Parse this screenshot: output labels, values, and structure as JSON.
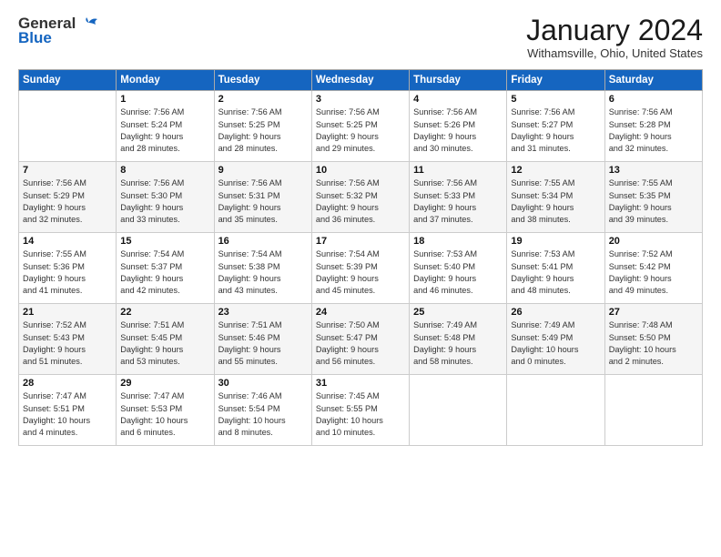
{
  "header": {
    "logo_general": "General",
    "logo_blue": "Blue",
    "month_title": "January 2024",
    "location": "Withamsville, Ohio, United States"
  },
  "days_of_week": [
    "Sunday",
    "Monday",
    "Tuesday",
    "Wednesday",
    "Thursday",
    "Friday",
    "Saturday"
  ],
  "weeks": [
    [
      {
        "day": "",
        "info": ""
      },
      {
        "day": "1",
        "info": "Sunrise: 7:56 AM\nSunset: 5:24 PM\nDaylight: 9 hours\nand 28 minutes."
      },
      {
        "day": "2",
        "info": "Sunrise: 7:56 AM\nSunset: 5:25 PM\nDaylight: 9 hours\nand 28 minutes."
      },
      {
        "day": "3",
        "info": "Sunrise: 7:56 AM\nSunset: 5:25 PM\nDaylight: 9 hours\nand 29 minutes."
      },
      {
        "day": "4",
        "info": "Sunrise: 7:56 AM\nSunset: 5:26 PM\nDaylight: 9 hours\nand 30 minutes."
      },
      {
        "day": "5",
        "info": "Sunrise: 7:56 AM\nSunset: 5:27 PM\nDaylight: 9 hours\nand 31 minutes."
      },
      {
        "day": "6",
        "info": "Sunrise: 7:56 AM\nSunset: 5:28 PM\nDaylight: 9 hours\nand 32 minutes."
      }
    ],
    [
      {
        "day": "7",
        "info": "Sunrise: 7:56 AM\nSunset: 5:29 PM\nDaylight: 9 hours\nand 32 minutes."
      },
      {
        "day": "8",
        "info": "Sunrise: 7:56 AM\nSunset: 5:30 PM\nDaylight: 9 hours\nand 33 minutes."
      },
      {
        "day": "9",
        "info": "Sunrise: 7:56 AM\nSunset: 5:31 PM\nDaylight: 9 hours\nand 35 minutes."
      },
      {
        "day": "10",
        "info": "Sunrise: 7:56 AM\nSunset: 5:32 PM\nDaylight: 9 hours\nand 36 minutes."
      },
      {
        "day": "11",
        "info": "Sunrise: 7:56 AM\nSunset: 5:33 PM\nDaylight: 9 hours\nand 37 minutes."
      },
      {
        "day": "12",
        "info": "Sunrise: 7:55 AM\nSunset: 5:34 PM\nDaylight: 9 hours\nand 38 minutes."
      },
      {
        "day": "13",
        "info": "Sunrise: 7:55 AM\nSunset: 5:35 PM\nDaylight: 9 hours\nand 39 minutes."
      }
    ],
    [
      {
        "day": "14",
        "info": "Sunrise: 7:55 AM\nSunset: 5:36 PM\nDaylight: 9 hours\nand 41 minutes."
      },
      {
        "day": "15",
        "info": "Sunrise: 7:54 AM\nSunset: 5:37 PM\nDaylight: 9 hours\nand 42 minutes."
      },
      {
        "day": "16",
        "info": "Sunrise: 7:54 AM\nSunset: 5:38 PM\nDaylight: 9 hours\nand 43 minutes."
      },
      {
        "day": "17",
        "info": "Sunrise: 7:54 AM\nSunset: 5:39 PM\nDaylight: 9 hours\nand 45 minutes."
      },
      {
        "day": "18",
        "info": "Sunrise: 7:53 AM\nSunset: 5:40 PM\nDaylight: 9 hours\nand 46 minutes."
      },
      {
        "day": "19",
        "info": "Sunrise: 7:53 AM\nSunset: 5:41 PM\nDaylight: 9 hours\nand 48 minutes."
      },
      {
        "day": "20",
        "info": "Sunrise: 7:52 AM\nSunset: 5:42 PM\nDaylight: 9 hours\nand 49 minutes."
      }
    ],
    [
      {
        "day": "21",
        "info": "Sunrise: 7:52 AM\nSunset: 5:43 PM\nDaylight: 9 hours\nand 51 minutes."
      },
      {
        "day": "22",
        "info": "Sunrise: 7:51 AM\nSunset: 5:45 PM\nDaylight: 9 hours\nand 53 minutes."
      },
      {
        "day": "23",
        "info": "Sunrise: 7:51 AM\nSunset: 5:46 PM\nDaylight: 9 hours\nand 55 minutes."
      },
      {
        "day": "24",
        "info": "Sunrise: 7:50 AM\nSunset: 5:47 PM\nDaylight: 9 hours\nand 56 minutes."
      },
      {
        "day": "25",
        "info": "Sunrise: 7:49 AM\nSunset: 5:48 PM\nDaylight: 9 hours\nand 58 minutes."
      },
      {
        "day": "26",
        "info": "Sunrise: 7:49 AM\nSunset: 5:49 PM\nDaylight: 10 hours\nand 0 minutes."
      },
      {
        "day": "27",
        "info": "Sunrise: 7:48 AM\nSunset: 5:50 PM\nDaylight: 10 hours\nand 2 minutes."
      }
    ],
    [
      {
        "day": "28",
        "info": "Sunrise: 7:47 AM\nSunset: 5:51 PM\nDaylight: 10 hours\nand 4 minutes."
      },
      {
        "day": "29",
        "info": "Sunrise: 7:47 AM\nSunset: 5:53 PM\nDaylight: 10 hours\nand 6 minutes."
      },
      {
        "day": "30",
        "info": "Sunrise: 7:46 AM\nSunset: 5:54 PM\nDaylight: 10 hours\nand 8 minutes."
      },
      {
        "day": "31",
        "info": "Sunrise: 7:45 AM\nSunset: 5:55 PM\nDaylight: 10 hours\nand 10 minutes."
      },
      {
        "day": "",
        "info": ""
      },
      {
        "day": "",
        "info": ""
      },
      {
        "day": "",
        "info": ""
      }
    ]
  ]
}
